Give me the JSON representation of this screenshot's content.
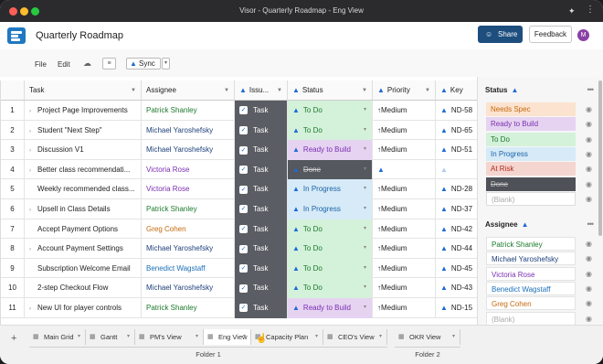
{
  "window": {
    "title": "Visor - Quarterly Roadmap - Eng View"
  },
  "header": {
    "doc_title": "Quarterly Roadmap",
    "share_label": "Share",
    "feedback_label": "Feedback",
    "avatar_initial": "M"
  },
  "toolbar": {
    "file_label": "File",
    "edit_label": "Edit",
    "sync_label": "Sync"
  },
  "grid": {
    "headers": {
      "task": "Task",
      "assignee": "Assignee",
      "issue": "Issu...",
      "status": "Status",
      "priority": "Priority",
      "key": "Key"
    },
    "rows": [
      {
        "num": "1",
        "task": "Project Page Improvements",
        "expand": true,
        "assignee": "Patrick Shanley",
        "issue": "Task",
        "status": "To Do",
        "priority": "Medium",
        "key": "ND-58"
      },
      {
        "num": "2",
        "task": "Student \"Next Step\"",
        "expand": true,
        "assignee": "Michael Yaroshefsky",
        "issue": "Task",
        "status": "To Do",
        "priority": "Medium",
        "key": "ND-65"
      },
      {
        "num": "3",
        "task": "Discussion V1",
        "expand": true,
        "assignee": "Michael Yaroshefsky",
        "issue": "Task",
        "status": "Ready to Build",
        "priority": "Medium",
        "key": "ND-51"
      },
      {
        "num": "4",
        "task": "Better class recommendati...",
        "expand": true,
        "assignee": "Victoria Rose",
        "issue": "Task",
        "status": "Done",
        "priority": "",
        "key": ""
      },
      {
        "num": "5",
        "task": "Weekly recommended class...",
        "expand": false,
        "assignee": "Victoria Rose",
        "issue": "Task",
        "status": "In Progress",
        "priority": "Medium",
        "key": "ND-28"
      },
      {
        "num": "6",
        "task": "Upsell in Class Details",
        "expand": true,
        "assignee": "Patrick Shanley",
        "issue": "Task",
        "status": "In Progress",
        "priority": "Medium",
        "key": "ND-37"
      },
      {
        "num": "7",
        "task": "Accept Payment Options",
        "expand": false,
        "assignee": "Greg Cohen",
        "issue": "Task",
        "status": "To Do",
        "priority": "Medium",
        "key": "ND-42"
      },
      {
        "num": "8",
        "task": "Account Payment Settings",
        "expand": true,
        "assignee": "Michael Yaroshefsky",
        "issue": "Task",
        "status": "To Do",
        "priority": "Medium",
        "key": "ND-44"
      },
      {
        "num": "9",
        "task": "Subscription Welcome Email",
        "expand": false,
        "assignee": "Benedict Wagstaff",
        "issue": "Task",
        "status": "To Do",
        "priority": "Medium",
        "key": "ND-45"
      },
      {
        "num": "10",
        "task": "2-step Checkout Flow",
        "expand": false,
        "assignee": "Michael Yaroshefsky",
        "issue": "Task",
        "status": "To Do",
        "priority": "Medium",
        "key": "ND-43"
      },
      {
        "num": "11",
        "task": "New UI for player controls",
        "expand": true,
        "assignee": "Patrick Shanley",
        "issue": "Task",
        "status": "Ready to Build",
        "priority": "Medium",
        "key": "ND-15"
      }
    ]
  },
  "side": {
    "status_title": "Status",
    "status_items": [
      {
        "label": "Needs Spec",
        "bg": "#fbe3cf",
        "fg": "#c5690f"
      },
      {
        "label": "Ready to Build",
        "bg": "#e6d3f1",
        "fg": "#7a2fb0"
      },
      {
        "label": "To Do",
        "bg": "#d4f1da",
        "fg": "#1b7a2c"
      },
      {
        "label": "In Progress",
        "bg": "#d6ebf7",
        "fg": "#1a60a8"
      },
      {
        "label": "At Risk",
        "bg": "#f5d5d0",
        "fg": "#b22a1c"
      },
      {
        "label": "Done",
        "bg": "#4e5157",
        "fg": "#c9c9c9"
      },
      {
        "label": "(Blank)",
        "bg": "#ffffff",
        "fg": "#aaaaaa"
      }
    ],
    "assignee_title": "Assignee",
    "assignee_items": [
      {
        "label": "Patrick Shanley",
        "fg": "#1b7a2c"
      },
      {
        "label": "Michael Yaroshefsky",
        "fg": "#1d3f7a"
      },
      {
        "label": "Victoria Rose",
        "fg": "#7a2fb0"
      },
      {
        "label": "Benedict Wagstaff",
        "fg": "#1a70b8"
      },
      {
        "label": "Greg Cohen",
        "fg": "#c5690f"
      },
      {
        "label": "(Blank)",
        "fg": "#aaaaaa"
      }
    ]
  },
  "tabs": [
    {
      "label": "Main Grid",
      "icon": "grid-icon"
    },
    {
      "label": "Gantt",
      "icon": "gantt-icon"
    },
    {
      "label": "PM's View",
      "icon": "view-icon"
    },
    {
      "label": "Eng View",
      "icon": "view-icon",
      "active": true
    },
    {
      "label": "Capacity Plan",
      "icon": "view-icon"
    },
    {
      "label": "CEO's View",
      "icon": "view-icon"
    },
    {
      "label": "OKR View",
      "icon": "view-icon"
    }
  ],
  "folders": {
    "folder1": "Folder 1",
    "folder2": "Folder 2"
  },
  "colors": {
    "status_todo_bg": "#d4f1da",
    "status_todo_fg": "#1b7a2c",
    "status_rtb_bg": "#e6d3f1",
    "status_rtb_fg": "#7a2fb0",
    "status_inprog_bg": "#d6ebf7",
    "status_inprog_fg": "#1a60a8",
    "status_done_bg": "#55585e",
    "status_done_fg": "#d0d0d0",
    "issue_bg": "#5a5d63"
  },
  "assignee_colors": {
    "Patrick Shanley": "#1b7a2c",
    "Michael Yaroshefsky": "#1d3f7a",
    "Victoria Rose": "#7a2fb0",
    "Greg Cohen": "#c5690f",
    "Benedict Wagstaff": "#1a70b8"
  }
}
